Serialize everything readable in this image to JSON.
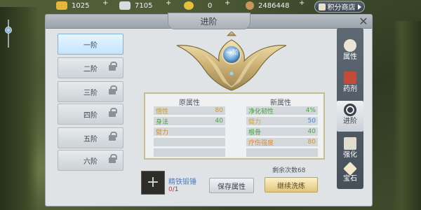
{
  "currencies": [
    {
      "name": "gold-ingot-icon",
      "value": "1025",
      "color": "#e6b53a"
    },
    {
      "name": "silver-ingot-icon",
      "value": "7105",
      "color": "#d6dbe0"
    },
    {
      "name": "gold-coin-icon",
      "value": "0",
      "color": "#e6c03a"
    },
    {
      "name": "copper-coin-icon",
      "value": "2486448",
      "color": "#c9965a"
    }
  ],
  "shop": {
    "label": "积分商店"
  },
  "panel": {
    "title": "进阶"
  },
  "tiers": [
    {
      "label": "一阶",
      "locked": false,
      "active": true
    },
    {
      "label": "二阶",
      "locked": true
    },
    {
      "label": "三阶",
      "locked": true
    },
    {
      "label": "四阶",
      "locked": true
    },
    {
      "label": "五阶",
      "locked": true
    },
    {
      "label": "六阶",
      "locked": true
    }
  ],
  "emblem": {
    "tier_label": "一阶"
  },
  "attributes": {
    "old_header": "原属性",
    "new_header": "新属性",
    "old": [
      {
        "name": "悟性",
        "value": "80",
        "color": "gold"
      },
      {
        "name": "身法",
        "value": "40",
        "color": "green"
      },
      {
        "name": "臂力",
        "value": "",
        "color": "orange"
      },
      {
        "name": "",
        "value": ""
      },
      {
        "name": "",
        "value": ""
      }
    ],
    "new": [
      {
        "name": "净化韧性",
        "value": "4%",
        "color": "green"
      },
      {
        "name": "臂力",
        "value": "50",
        "color": "blue"
      },
      {
        "name": "根骨",
        "value": "40",
        "color": "green"
      },
      {
        "name": "疗伤强度",
        "value": "80",
        "color": "orange"
      },
      {
        "name": "",
        "value": ""
      }
    ]
  },
  "remaining": "剩余次数68",
  "item": {
    "name": "精铁锻锤",
    "have": "0",
    "total": "/1"
  },
  "buttons": {
    "save": "保存属性",
    "wash": "继续洗练"
  },
  "side_tabs": [
    {
      "label": "属性",
      "icon": "character-icon",
      "active": false
    },
    {
      "label": "药剂",
      "icon": "potion-icon",
      "active": false
    },
    {
      "label": "进阶",
      "icon": "advance-icon",
      "active": true
    },
    {
      "label": "强化",
      "icon": "hammer-icon",
      "active": false
    },
    {
      "label": "宝石",
      "icon": "gem-icon",
      "active": false
    }
  ]
}
